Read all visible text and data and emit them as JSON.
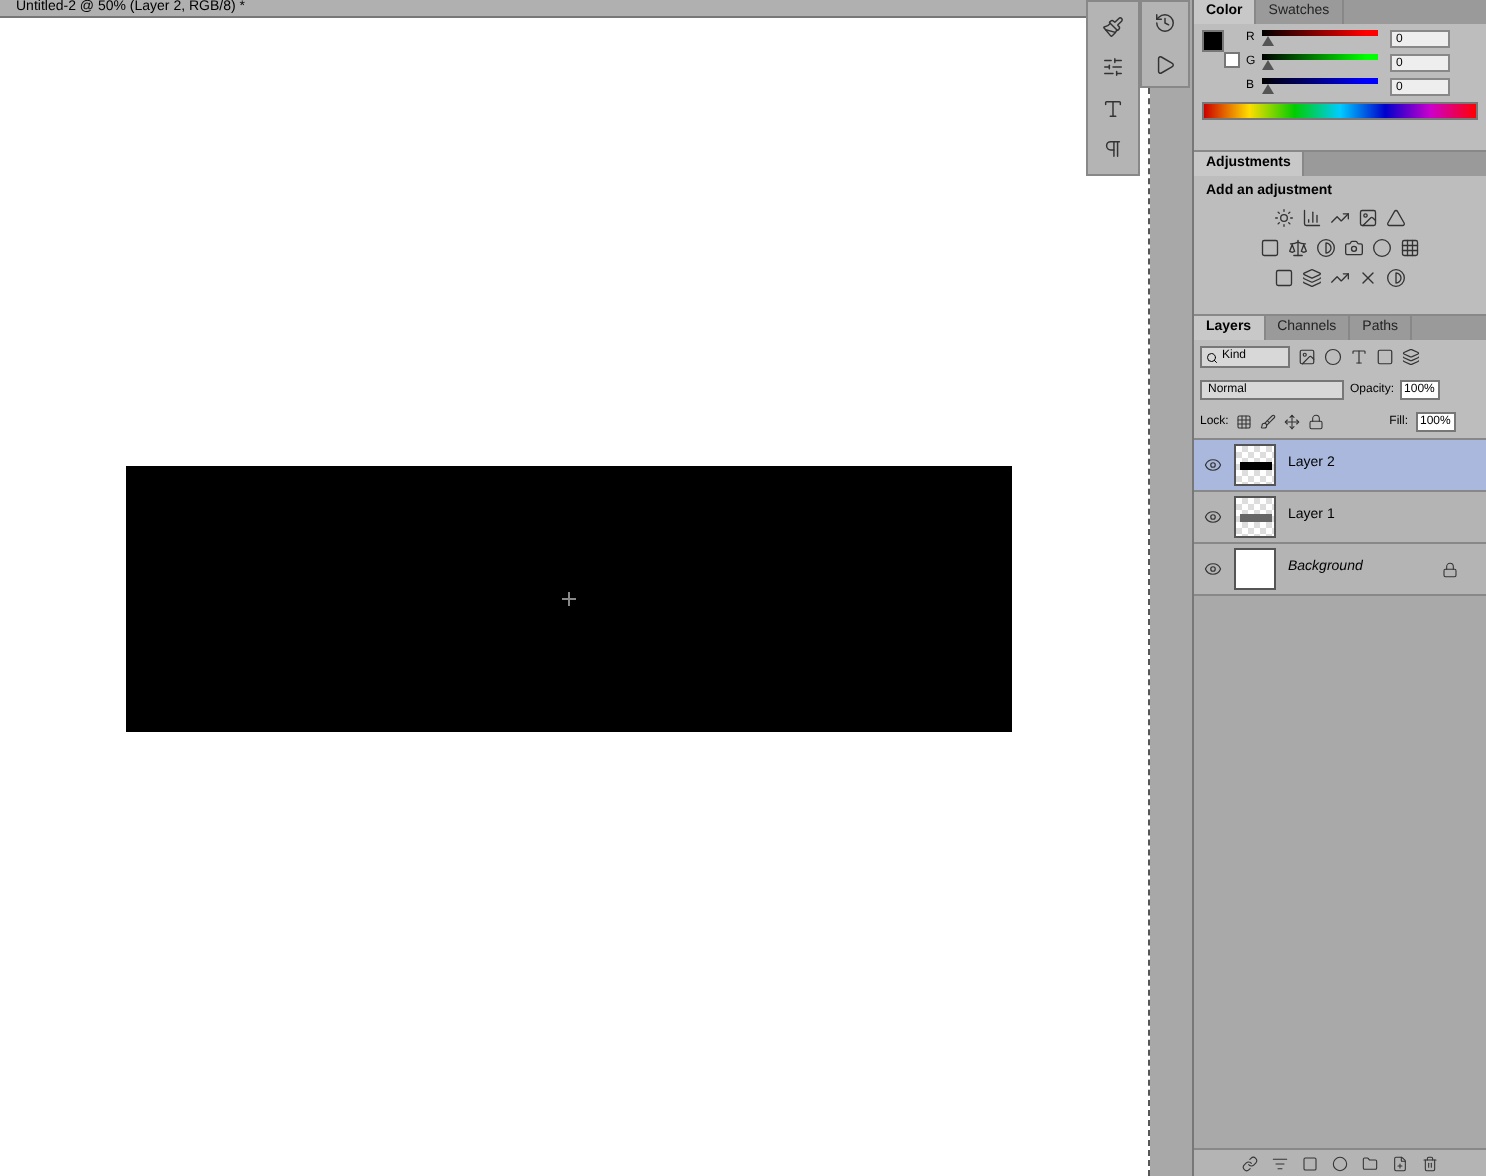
{
  "document": {
    "title": "Untitled-2 @ 50% (Layer 2, RGB/8) *"
  },
  "color_panel": {
    "tabs": [
      {
        "label": "Color",
        "selected": true
      },
      {
        "label": "Swatches",
        "selected": false
      }
    ],
    "channels": [
      {
        "name": "R",
        "level": 0,
        "value": "0",
        "color": "#ff0000"
      },
      {
        "name": "G",
        "level": 0,
        "value": "0",
        "color": "#00ff00"
      },
      {
        "name": "B",
        "level": 0,
        "value": "0",
        "color": "#0000ff"
      }
    ]
  },
  "adjustments_panel": {
    "tab": "Adjustments",
    "heading": "Add an adjustment"
  },
  "layers_panel": {
    "tabs": [
      {
        "label": "Layers",
        "selected": true
      },
      {
        "label": "Channels",
        "selected": false
      },
      {
        "label": "Paths",
        "selected": false
      }
    ],
    "filter": "Kind",
    "blend_mode": "Normal",
    "opacity_label": "Opacity:",
    "opacity": "100%",
    "lock_label": "Lock:",
    "fill_label": "Fill:",
    "fill": "100%",
    "layers": [
      {
        "name": "Layer 2",
        "kind": "bar-black",
        "selected": true,
        "visible": true,
        "locked": false,
        "italic": false
      },
      {
        "name": "Layer 1",
        "kind": "bar-gray",
        "selected": false,
        "visible": true,
        "locked": false,
        "italic": false
      },
      {
        "name": "Background",
        "kind": "white",
        "selected": false,
        "visible": true,
        "locked": true,
        "italic": true
      }
    ]
  }
}
